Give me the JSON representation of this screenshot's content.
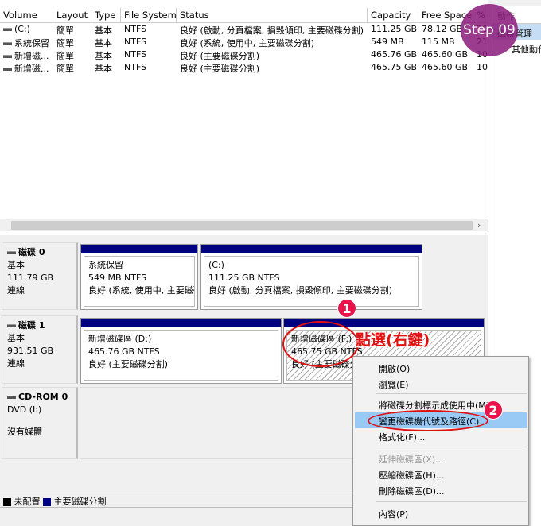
{
  "table": {
    "headers": [
      "Volume",
      "Layout",
      "Type",
      "File System",
      "Status",
      "Capacity",
      "Free Space",
      "%"
    ],
    "rows": [
      [
        "(C:)",
        "簡單",
        "基本",
        "NTFS",
        "良好 (啟動, 分頁檔案, 損毀傾印, 主要磁碟分割)",
        "111.25 GB",
        "78.12 GB",
        "70"
      ],
      [
        "系統保留",
        "簡單",
        "基本",
        "NTFS",
        "良好 (系統, 使用中, 主要磁碟分割)",
        "549 MB",
        "115 MB",
        "21"
      ],
      [
        "新增磁...",
        "簡單",
        "基本",
        "NTFS",
        "良好 (主要磁碟分割)",
        "465.76 GB",
        "465.60 GB",
        "10"
      ],
      [
        "新增磁...",
        "簡單",
        "基本",
        "NTFS",
        "良好 (主要磁碟分割)",
        "465.75 GB",
        "465.60 GB",
        "10"
      ]
    ]
  },
  "actions": {
    "title": "動作",
    "header": "磁碟管理",
    "more": "其他動作"
  },
  "disks": [
    {
      "name": "磁碟 0",
      "type": "基本",
      "size": "111.79 GB",
      "state": "連線",
      "parts": [
        {
          "name": "系統保留",
          "size": "549 MB NTFS",
          "status": "良好 (系統, 使用中, 主要磁碟"
        },
        {
          "name": "(C:)",
          "size": "111.25 GB NTFS",
          "status": "良好 (啟動, 分頁檔案, 損毀傾印, 主要磁碟分割)"
        }
      ]
    },
    {
      "name": "磁碟 1",
      "type": "基本",
      "size": "931.51 GB",
      "state": "連線",
      "parts": [
        {
          "name": "新增磁碟區  (D:)",
          "size": "465.76 GB NTFS",
          "status": "良好 (主要磁碟分割)"
        },
        {
          "name": "新增磁碟區  (F:)",
          "size": "465.75 GB NTFS",
          "status": "良好 (主要磁碟分割)"
        }
      ]
    },
    {
      "name": "CD-ROM 0",
      "type": "DVD (I:)",
      "state": "沒有媒體"
    }
  ],
  "legend": [
    {
      "label": "未配置",
      "color": "#000000"
    },
    {
      "label": "主要磁碟分割",
      "color": "#000080"
    }
  ],
  "menu": {
    "items": [
      "開啟(O)",
      "瀏覽(E)",
      "將磁碟分割標示成使用中(M)",
      "變更磁碟機代號及路徑(C)...",
      "格式化(F)...",
      "延伸磁碟區(X)...",
      "壓縮磁碟區(H)...",
      "刪除磁碟區(D)...",
      "內容(P)"
    ],
    "selected": "變更磁碟機代號及路徑(C)...",
    "disabled": [
      "延伸磁碟區(X)..."
    ]
  },
  "annotations": {
    "step": "Step 09",
    "badge1": "1",
    "badge2": "2",
    "callout": "點選(右鍵)",
    "step_color": "#8b1a7a",
    "badge_color": "#e8144a"
  }
}
